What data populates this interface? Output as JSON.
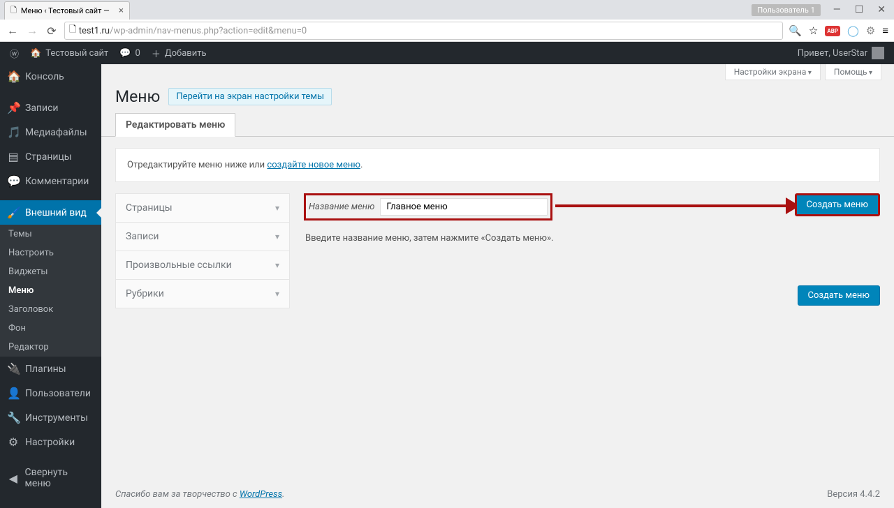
{
  "browser": {
    "tab_title": "Меню ‹ Тестовый сайт —",
    "profile_label": "Пользователь 1",
    "url_host": "test1.ru",
    "url_path": "/wp-admin/nav-menus.php?action=edit&menu=0",
    "abp": "ABP"
  },
  "adminbar": {
    "site_name": "Тестовый сайт",
    "comments_count": "0",
    "add_new": "Добавить",
    "greeting": "Привет, UserStar"
  },
  "sidebar": {
    "items": [
      {
        "label": "Консоль",
        "icon": "dashboard"
      },
      {
        "label": "Записи",
        "icon": "pin"
      },
      {
        "label": "Медиафайлы",
        "icon": "media"
      },
      {
        "label": "Страницы",
        "icon": "pages"
      },
      {
        "label": "Комментарии",
        "icon": "comments"
      },
      {
        "label": "Внешний вид",
        "icon": "appearance",
        "active": true
      },
      {
        "label": "Плагины",
        "icon": "plugins"
      },
      {
        "label": "Пользователи",
        "icon": "users"
      },
      {
        "label": "Инструменты",
        "icon": "tools"
      },
      {
        "label": "Настройки",
        "icon": "settings"
      },
      {
        "label": "Свернуть меню",
        "icon": "collapse"
      }
    ],
    "submenu": [
      "Темы",
      "Настроить",
      "Виджеты",
      "Меню",
      "Заголовок",
      "Фон",
      "Редактор"
    ],
    "submenu_current": "Меню"
  },
  "screen_meta": {
    "options": "Настройки экрана",
    "help": "Помощь"
  },
  "content": {
    "heading": "Меню",
    "page_action": "Перейти на экран настройки темы",
    "tab_edit": "Редактировать меню",
    "notice_prefix": "Отредактируйте меню ниже или ",
    "notice_link": "создайте новое меню",
    "accordion": [
      "Страницы",
      "Записи",
      "Произвольные ссылки",
      "Рубрики"
    ],
    "menu_name_label": "Название меню",
    "menu_name_value": "Главное меню",
    "hint": "Введите название меню, затем нажмите «Создать меню».",
    "create_btn": "Создать меню"
  },
  "footer": {
    "thanks_prefix": "Спасибо вам за творчество с ",
    "wp_link": "WordPress",
    "version": "Версия 4.4.2"
  }
}
